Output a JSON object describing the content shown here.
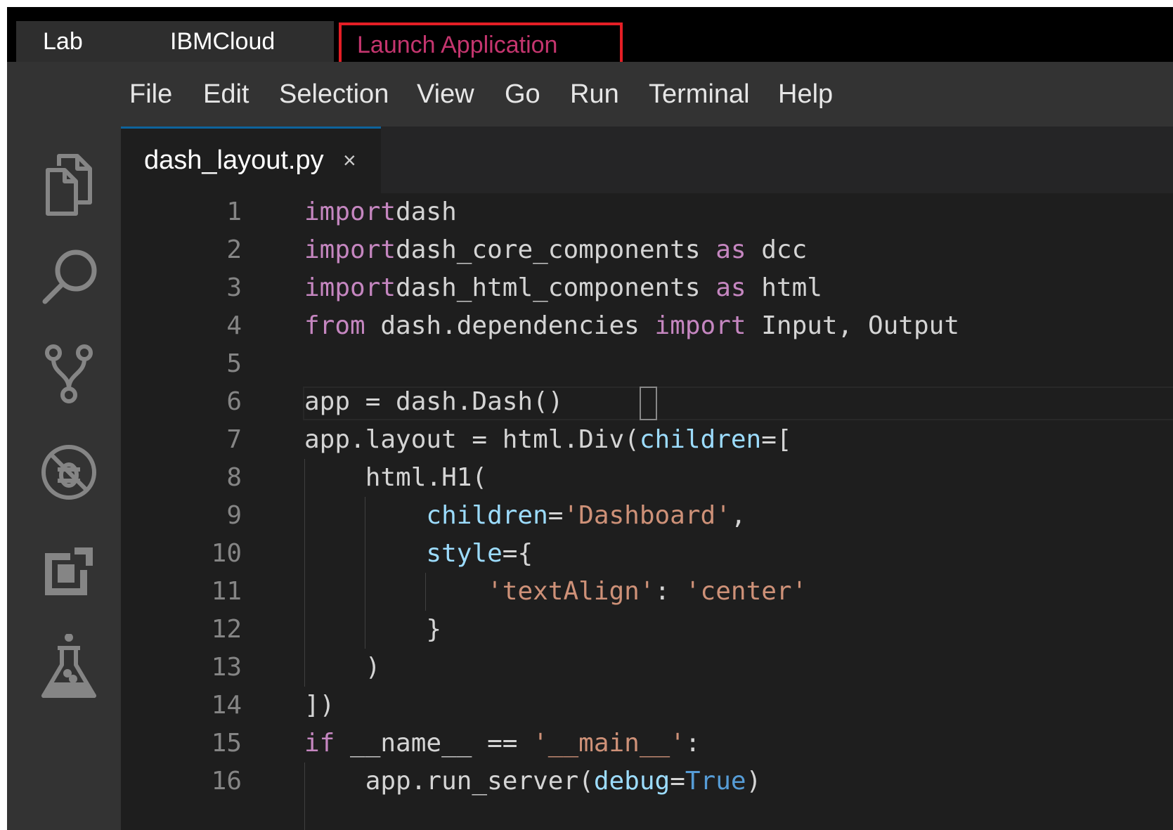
{
  "top_tabs": {
    "lab": "Lab",
    "ibmcloud": "IBMCloud",
    "launch": "Launch Application"
  },
  "menu": [
    "File",
    "Edit",
    "Selection",
    "View",
    "Go",
    "Run",
    "Terminal",
    "Help"
  ],
  "activity_icons": [
    "explorer-icon",
    "search-icon",
    "source-control-icon",
    "debug-icon",
    "extensions-icon",
    "lab-flask-icon"
  ],
  "editor": {
    "file_name": "dash_layout.py",
    "close_glyph": "×"
  },
  "code_lines": [
    {
      "n": "1",
      "tokens": [
        [
          "kw",
          "import"
        ],
        [
          "",
          "dash"
        ]
      ]
    },
    {
      "n": "2",
      "tokens": [
        [
          "kw",
          "import"
        ],
        [
          "",
          "dash_core_components "
        ],
        [
          "kw",
          "as"
        ],
        [
          "",
          " dcc"
        ]
      ]
    },
    {
      "n": "3",
      "tokens": [
        [
          "kw",
          "import"
        ],
        [
          "",
          "dash_html_components "
        ],
        [
          "kw",
          "as"
        ],
        [
          "",
          " html"
        ]
      ]
    },
    {
      "n": "4",
      "tokens": [
        [
          "kw",
          "from"
        ],
        [
          "",
          " dash.dependencies "
        ],
        [
          "kw",
          "import"
        ],
        [
          "",
          " Input, Output"
        ]
      ]
    },
    {
      "n": "5",
      "tokens": []
    },
    {
      "n": "6",
      "tokens": [
        [
          "",
          "app = dash.Dash()"
        ]
      ]
    },
    {
      "n": "7",
      "tokens": [
        [
          "",
          "app.layout = html.Div("
        ],
        [
          "param",
          "children"
        ],
        [
          "",
          "=["
        ]
      ]
    },
    {
      "n": "8",
      "tokens": [
        [
          "",
          "    html.H1("
        ]
      ]
    },
    {
      "n": "9",
      "tokens": [
        [
          "",
          "        "
        ],
        [
          "param",
          "children"
        ],
        [
          "",
          "="
        ],
        [
          "str",
          "'Dashboard'"
        ],
        [
          "",
          ","
        ]
      ]
    },
    {
      "n": "10",
      "tokens": [
        [
          "",
          "        "
        ],
        [
          "param",
          "style"
        ],
        [
          "",
          "={"
        ]
      ]
    },
    {
      "n": "11",
      "tokens": [
        [
          "",
          "            "
        ],
        [
          "str",
          "'textAlign'"
        ],
        [
          "",
          ": "
        ],
        [
          "str",
          "'center'"
        ]
      ]
    },
    {
      "n": "12",
      "tokens": [
        [
          "",
          "        }"
        ]
      ]
    },
    {
      "n": "13",
      "tokens": [
        [
          "",
          "    )"
        ]
      ]
    },
    {
      "n": "14",
      "tokens": [
        [
          "",
          "])"
        ]
      ]
    },
    {
      "n": "15",
      "tokens": [
        [
          "kw",
          "if"
        ],
        [
          "",
          " __name__ == "
        ],
        [
          "str",
          "'__main__'"
        ],
        [
          "",
          ":"
        ]
      ]
    },
    {
      "n": "16",
      "tokens": [
        [
          "",
          "    app.run_server("
        ],
        [
          "param",
          "debug"
        ],
        [
          "",
          "="
        ],
        [
          "bool",
          "True"
        ],
        [
          "",
          ")"
        ]
      ]
    }
  ],
  "colors": {
    "keyword": "#c586c0",
    "string": "#ce9178",
    "parameter": "#9cdcfe",
    "boolean": "#569cd6",
    "highlight_border": "#e41e25",
    "launch_text": "#c4356e"
  }
}
